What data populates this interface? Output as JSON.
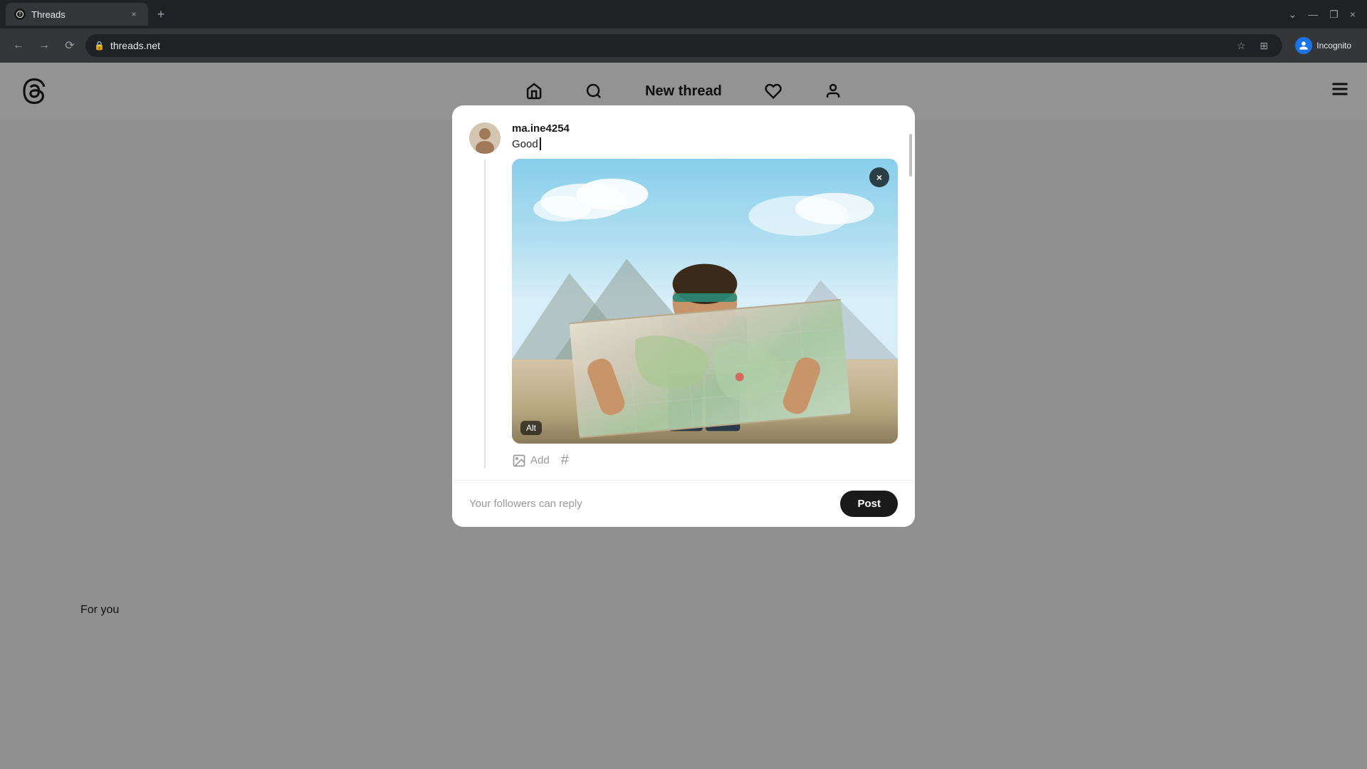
{
  "browser": {
    "tab": {
      "favicon": "@",
      "title": "Threads",
      "close_icon": "×"
    },
    "new_tab_icon": "+",
    "window_controls": {
      "chevron_down": "⌄",
      "minimize": "—",
      "restore": "❐",
      "close": "×"
    },
    "address_bar": {
      "lock_icon": "🔒",
      "url": "threads.net",
      "star_icon": "☆",
      "extension_icon": "⊞",
      "incognito_label": "Incognito"
    }
  },
  "app": {
    "logo": "@",
    "nav": {
      "home_icon": "⌂",
      "search_icon": "⌕",
      "title": "New thread",
      "heart_icon": "♡",
      "profile_icon": "○"
    },
    "hamburger": "≡",
    "for_you_label": "For you"
  },
  "modal": {
    "username": "ma.ine4254",
    "text_value": "Good",
    "image": {
      "alt_label": "Alt",
      "close_btn": "×"
    },
    "actions": {
      "add_label": "Add",
      "hashtag_icon": "#"
    },
    "footer": {
      "followers_text": "Your followers can reply",
      "post_btn_label": "Post"
    }
  }
}
